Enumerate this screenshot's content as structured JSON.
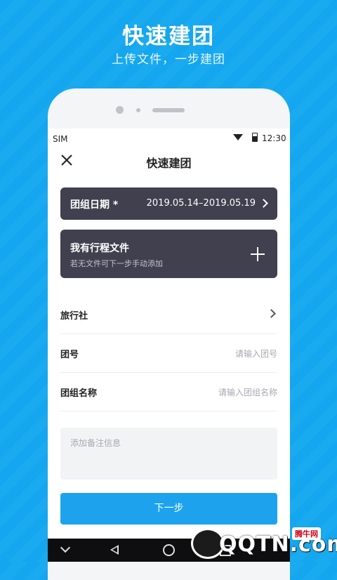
{
  "promo": {
    "title": "快速建团",
    "subtitle": "上传文件，一步建团"
  },
  "status_bar": {
    "carrier": "SIM",
    "time": "12:30",
    "icons": [
      "wifi-icon",
      "battery-icon"
    ]
  },
  "nav": {
    "title": "快速建团",
    "close_icon": "close-icon"
  },
  "date_card": {
    "label": "团组日期",
    "required_mark": "*",
    "value": "2019.05.14–2019.05.19"
  },
  "file_card": {
    "label": "我有行程文件",
    "hint": "若无文件可下一步手动添加"
  },
  "form": {
    "agency_label": "旅行社",
    "group_no_label": "团号",
    "group_no_placeholder": "请输入团号",
    "group_name_label": "团组名称",
    "group_name_placeholder": "请输入团组名称",
    "notes_placeholder": "添加备注信息"
  },
  "next_button": "下一步",
  "watermark": {
    "text": "QQTN.com",
    "badge": "腾牛网"
  },
  "colors": {
    "background": "#14a6ee",
    "card": "#40404f",
    "accent": "#1da3ee"
  }
}
